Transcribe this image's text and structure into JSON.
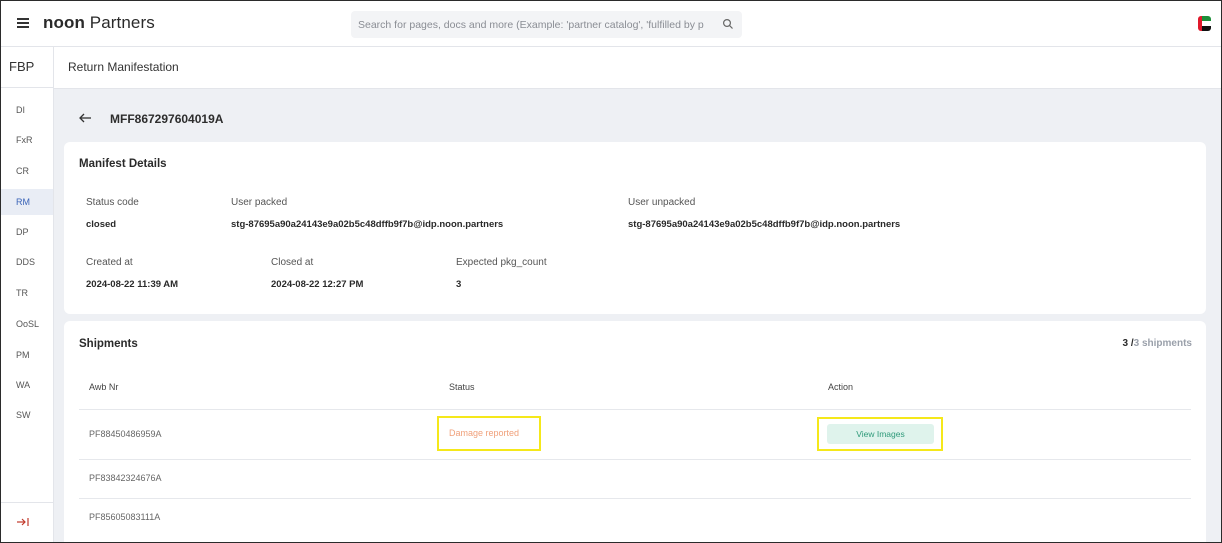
{
  "topbar": {
    "brand_bold": "noon",
    "brand_rest": " Partners",
    "search_placeholder": "Search for pages, docs and more (Example: 'partner catalog', 'fulfilled by p"
  },
  "sidebar": {
    "header": "FBP",
    "items": [
      {
        "label": "DI",
        "active": false
      },
      {
        "label": "FxR",
        "active": false
      },
      {
        "label": "CR",
        "active": false
      },
      {
        "label": "RM",
        "active": true
      },
      {
        "label": "DP",
        "active": false
      },
      {
        "label": "DDS",
        "active": false
      },
      {
        "label": "TR",
        "active": false
      },
      {
        "label": "OoSL",
        "active": false
      },
      {
        "label": "PM",
        "active": false
      },
      {
        "label": "WA",
        "active": false
      },
      {
        "label": "SW",
        "active": false
      }
    ]
  },
  "page": {
    "title": "Return Manifestation",
    "manifest_id": "MFF867297604019A"
  },
  "details": {
    "title": "Manifest Details",
    "status_code_label": "Status code",
    "status_code": "closed",
    "user_packed_label": "User packed",
    "user_packed": "stg-87695a90a24143e9a02b5c48dffb9f7b@idp.noon.partners",
    "user_unpacked_label": "User unpacked",
    "user_unpacked": "stg-87695a90a24143e9a02b5c48dffb9f7b@idp.noon.partners",
    "created_at_label": "Created at",
    "created_at": "2024-08-22 11:39 AM",
    "closed_at_label": "Closed at",
    "closed_at": "2024-08-22 12:27 PM",
    "expected_label": "Expected pkg_count",
    "expected": "3"
  },
  "shipments": {
    "title": "Shipments",
    "count_done": "3 /",
    "count_total": "3 shipments",
    "columns": {
      "awb": "Awb Nr",
      "status": "Status",
      "action": "Action"
    },
    "rows": [
      {
        "awb": "PF88450486959A",
        "status": "Damage reported",
        "action": "View Images"
      },
      {
        "awb": "PF83842324676A",
        "status": "",
        "action": ""
      },
      {
        "awb": "PF85605083111A",
        "status": "",
        "action": ""
      }
    ]
  },
  "colors": {
    "accent_blue": "#3a64b8",
    "status_orange": "#f0a07a",
    "action_green": "#2f9a7a",
    "highlight_yellow": "#f5e81a"
  }
}
